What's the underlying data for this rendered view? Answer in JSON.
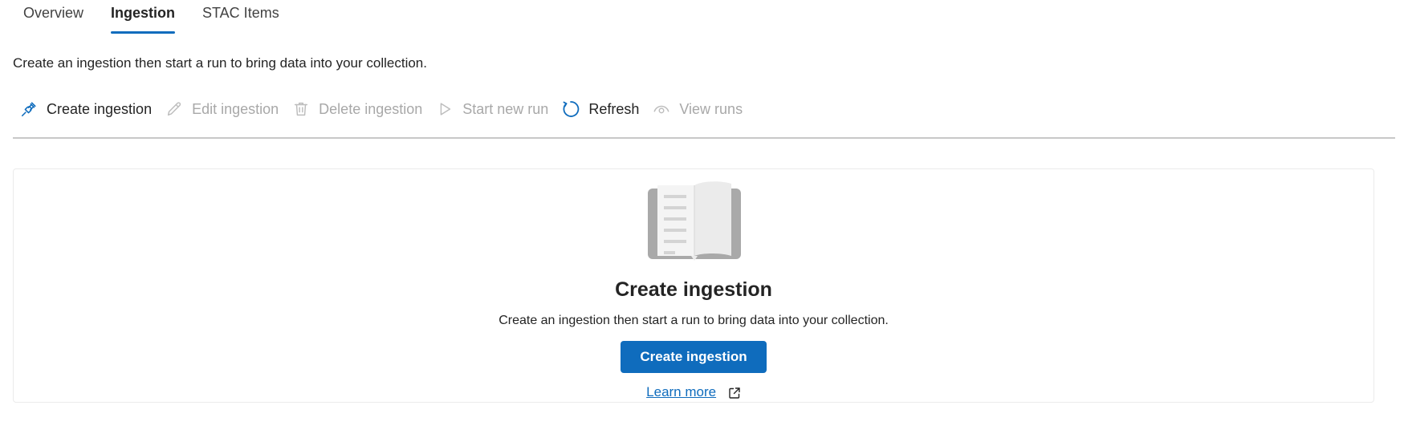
{
  "tabs": [
    {
      "label": "Overview",
      "active": false
    },
    {
      "label": "Ingestion",
      "active": true
    },
    {
      "label": "STAC Items",
      "active": false
    }
  ],
  "description": "Create an ingestion then start a run to bring data into your collection.",
  "toolbar": {
    "create_label": "Create ingestion",
    "edit_label": "Edit ingestion",
    "delete_label": "Delete ingestion",
    "start_run_label": "Start new run",
    "refresh_label": "Refresh",
    "view_runs_label": "View runs"
  },
  "empty_state": {
    "title": "Create ingestion",
    "description": "Create an ingestion then start a run to bring data into your collection.",
    "button_label": "Create ingestion",
    "link_label": "Learn more"
  },
  "colors": {
    "accent": "#0f6cbd",
    "disabled_text": "#a8a8a8",
    "text": "#242424"
  },
  "icons": {
    "create": "link-plug-icon",
    "edit": "pencil-icon",
    "delete": "trash-icon",
    "start_run": "play-icon",
    "refresh": "refresh-icon",
    "view_runs": "eye-icon",
    "illustration": "open-book-icon",
    "external": "external-link-icon"
  }
}
